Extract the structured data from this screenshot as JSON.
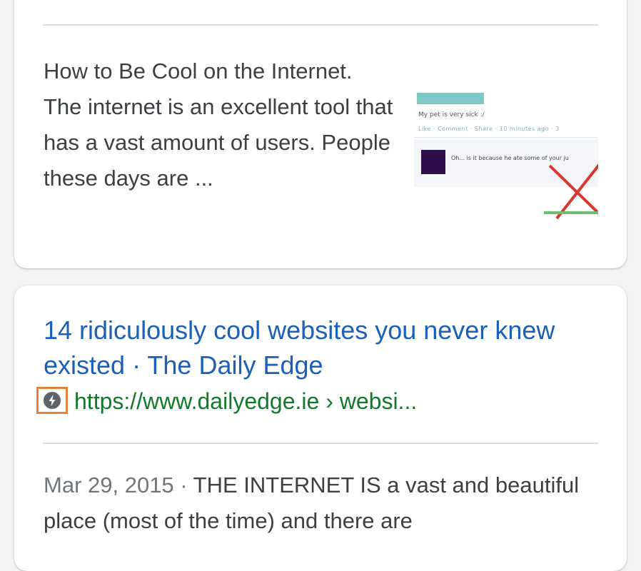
{
  "result_1": {
    "snippet": "How to Be Cool on the Internet. The internet is an excellent tool that has a vast amount of users. People these days are ...",
    "thumbnail": {
      "post_text": "My pet is very sick :/",
      "meta_text": "Like · Comment · Share · 10 minutes ago · 3",
      "comment_text": "Oh... is it because he ate some of your ju"
    }
  },
  "result_2": {
    "title": "14 ridiculously cool websites you never knew existed · The Daily Edge",
    "url": "https://www.dailyedge.ie › websi...",
    "amp_icon": "amp-lightning-icon",
    "date": "Mar 29, 2015 · ",
    "snippet": "THE INTERNET IS a vast and beautiful place (most of the time) and there are"
  },
  "colors": {
    "link": "#1a5fb8",
    "url": "#117a2a",
    "highlight": "#e8823a"
  }
}
